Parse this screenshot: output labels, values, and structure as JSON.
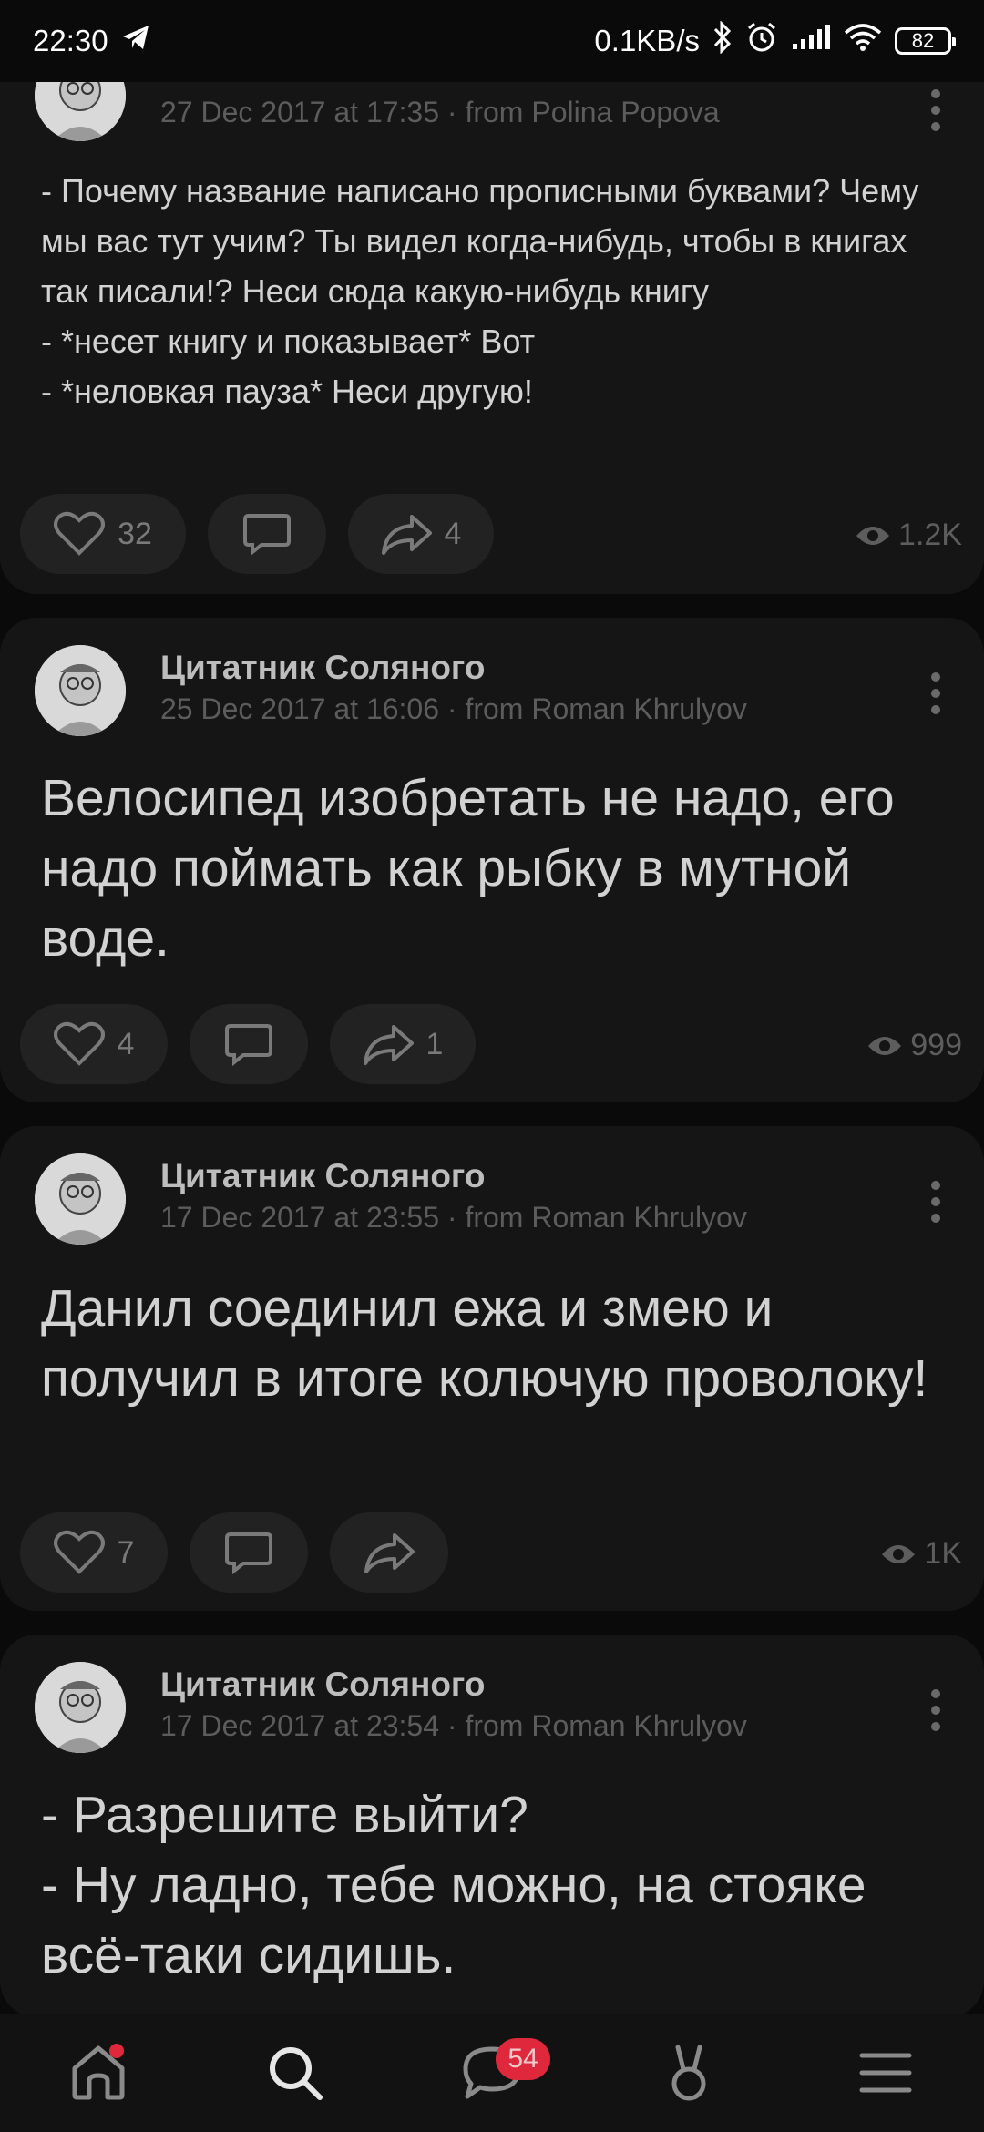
{
  "status_bar": {
    "time": "22:30",
    "network_speed": "0.1KB/s",
    "battery": "82",
    "icons": [
      "telegram-icon",
      "bluetooth-icon",
      "alarm-icon",
      "signal-icon",
      "wifi-icon",
      "battery-icon"
    ]
  },
  "posts": [
    {
      "author": "",
      "meta": "27 Dec 2017 at 17:35 · from Polina Popova",
      "text": "- Почему название написано прописными буквами? Чему мы вас тут учим? Ты видел когда-нибудь, чтобы в книгах так писали!? Неси сюда какую-нибудь книгу\n- *несет книгу и показывает* Вот\n- *неловкая пауза* Неси другую!",
      "likes": "32",
      "shares": "4",
      "views": "1.2K"
    },
    {
      "author": "Цитатник Соляного",
      "meta": "25 Dec 2017 at 16:06 · from Roman Khrulyov",
      "text": "Велосипед изобретать не надо, его надо поймать как рыбку в мутной воде.",
      "likes": "4",
      "shares": "1",
      "views": "999"
    },
    {
      "author": "Цитатник Соляного",
      "meta": "17 Dec 2017 at 23:55 · from Roman Khrulyov",
      "text": "Данил соединил ежа и змею и получил в итоге колючую проволоку!",
      "likes": "7",
      "shares": "",
      "views": "1K"
    },
    {
      "author": "Цитатник Соляного",
      "meta": "17 Dec 2017 at 23:54 · from Roman Khrulyov",
      "text": "- Разрешите выйти?\n- Ну ладно, тебе можно, на стояке всё-таки сидишь.",
      "likes": "",
      "shares": "",
      "views": ""
    }
  ],
  "bottom_nav": {
    "items": [
      "home-icon",
      "search-icon",
      "messages-icon",
      "services-icon",
      "menu-icon"
    ],
    "messages_badge": "54"
  },
  "colors": {
    "background": "#0a0a0a",
    "card": "#151515",
    "pill": "#222222",
    "badge": "#e0283c"
  }
}
